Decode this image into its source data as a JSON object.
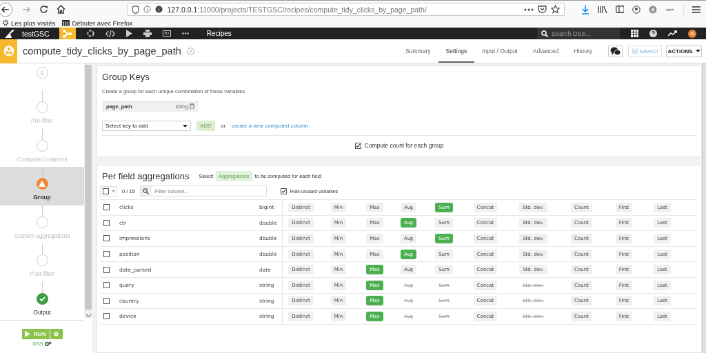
{
  "browser": {
    "url": "**127.0.0.1**:11000/projects/TESTGSC/recipes/compute_tidy_clicks_by_page_path/",
    "bookmarks": [
      "Les plus visités",
      "Débuter avec Firefox"
    ]
  },
  "topbar": {
    "project": "testGSC",
    "section": "Recipes",
    "search": {
      "placeholder": "Search DSS..."
    },
    "avatar": "A"
  },
  "recipe": {
    "title": "compute_tidy_clicks_by_page_path",
    "tabs": [
      {
        "label": "Summary",
        "selected": false
      },
      {
        "label": "Settings",
        "selected": true
      },
      {
        "label": "Input / Output",
        "selected": false
      },
      {
        "label": "Advanced",
        "selected": false
      },
      {
        "label": "History",
        "selected": false
      }
    ],
    "saved": "SAVED!",
    "actions": "ACTIONS"
  },
  "steps": [
    {
      "kind": "input",
      "selected": false
    },
    {
      "kind": "empty",
      "label": "Pre-filter",
      "selected": false
    },
    {
      "kind": "empty",
      "label": "Computed columns",
      "selected": false
    },
    {
      "kind": "warning",
      "label": "Group",
      "selected": true
    },
    {
      "kind": "empty",
      "label": "Custom aggregations",
      "selected": false
    },
    {
      "kind": "empty",
      "label": "Post-filter",
      "selected": false
    },
    {
      "kind": "done",
      "label": "Output",
      "selected": false
    }
  ],
  "run": {
    "label": "RUN",
    "engine": "DSS"
  },
  "group_keys": {
    "title": "Group Keys",
    "description": "Create a group for each unique combination of these variables",
    "keys": [
      {
        "name": "page_path",
        "type": "string"
      }
    ],
    "select": {
      "placeholder": "Select key to add"
    },
    "add": "ADD",
    "or": "or",
    "link": "create a new computed column",
    "compute_count": {
      "label": "Compute count for each group",
      "checked": true
    }
  },
  "aggregations": {
    "title": "Per field aggregations",
    "hint_before": "Select",
    "hint_tag": "Aggregations",
    "hint_after": "to be computed for each field",
    "counter": "0 / 15",
    "filter": {
      "placeholder": "Filter column..."
    },
    "hide_unused": {
      "label": "Hide unused variables",
      "checked": true
    },
    "rows": [
      {
        "name": "clicks",
        "type": "bigint",
        "checked": false,
        "aggs": [
          {
            "label": "Distinct",
            "selected": false,
            "disabled": false
          },
          {
            "label": "Min",
            "selected": false,
            "disabled": false
          },
          {
            "label": "Max",
            "selected": false,
            "disabled": false
          },
          {
            "label": "Avg",
            "selected": false,
            "disabled": false
          },
          {
            "label": "Sum",
            "selected": true,
            "disabled": false
          },
          {
            "label": "Concat",
            "selected": false,
            "disabled": false
          },
          {
            "label": "Std. dev.",
            "selected": false,
            "disabled": false
          },
          {
            "label": "Count",
            "selected": false,
            "disabled": false
          },
          {
            "label": "First",
            "selected": false,
            "disabled": false
          },
          {
            "label": "Last",
            "selected": false,
            "disabled": false
          }
        ]
      },
      {
        "name": "ctr",
        "type": "double",
        "checked": false,
        "aggs": [
          {
            "label": "Distinct",
            "selected": false,
            "disabled": false
          },
          {
            "label": "Min",
            "selected": false,
            "disabled": false
          },
          {
            "label": "Max",
            "selected": false,
            "disabled": false
          },
          {
            "label": "Avg",
            "selected": true,
            "disabled": false
          },
          {
            "label": "Sum",
            "selected": false,
            "disabled": false
          },
          {
            "label": "Concat",
            "selected": false,
            "disabled": false
          },
          {
            "label": "Std. dev.",
            "selected": false,
            "disabled": false
          },
          {
            "label": "Count",
            "selected": false,
            "disabled": false
          },
          {
            "label": "First",
            "selected": false,
            "disabled": false
          },
          {
            "label": "Last",
            "selected": false,
            "disabled": false
          }
        ]
      },
      {
        "name": "impressions",
        "type": "double",
        "checked": false,
        "aggs": [
          {
            "label": "Distinct",
            "selected": false,
            "disabled": false
          },
          {
            "label": "Min",
            "selected": false,
            "disabled": false
          },
          {
            "label": "Max",
            "selected": false,
            "disabled": false
          },
          {
            "label": "Avg",
            "selected": false,
            "disabled": false
          },
          {
            "label": "Sum",
            "selected": true,
            "disabled": false
          },
          {
            "label": "Concat",
            "selected": false,
            "disabled": false
          },
          {
            "label": "Std. dev.",
            "selected": false,
            "disabled": false
          },
          {
            "label": "Count",
            "selected": false,
            "disabled": false
          },
          {
            "label": "First",
            "selected": false,
            "disabled": false
          },
          {
            "label": "Last",
            "selected": false,
            "disabled": false
          }
        ]
      },
      {
        "name": "position",
        "type": "double",
        "checked": false,
        "aggs": [
          {
            "label": "Distinct",
            "selected": false,
            "disabled": false
          },
          {
            "label": "Min",
            "selected": false,
            "disabled": false
          },
          {
            "label": "Max",
            "selected": false,
            "disabled": false
          },
          {
            "label": "Avg",
            "selected": true,
            "disabled": false
          },
          {
            "label": "Sum",
            "selected": false,
            "disabled": false
          },
          {
            "label": "Concat",
            "selected": false,
            "disabled": false
          },
          {
            "label": "Std. dev.",
            "selected": false,
            "disabled": false
          },
          {
            "label": "Count",
            "selected": false,
            "disabled": false
          },
          {
            "label": "First",
            "selected": false,
            "disabled": false
          },
          {
            "label": "Last",
            "selected": false,
            "disabled": false
          }
        ]
      },
      {
        "name": "date_parsed",
        "type": "date",
        "checked": false,
        "aggs": [
          {
            "label": "Distinct",
            "selected": false,
            "disabled": false
          },
          {
            "label": "Min",
            "selected": false,
            "disabled": false
          },
          {
            "label": "Max",
            "selected": true,
            "disabled": false
          },
          {
            "label": "Avg",
            "selected": false,
            "disabled": false
          },
          {
            "label": "Sum",
            "selected": false,
            "disabled": false
          },
          {
            "label": "Concat",
            "selected": false,
            "disabled": false
          },
          {
            "label": "Std. dev.",
            "selected": false,
            "disabled": false
          },
          {
            "label": "Count",
            "selected": false,
            "disabled": false
          },
          {
            "label": "First",
            "selected": false,
            "disabled": false
          },
          {
            "label": "Last",
            "selected": false,
            "disabled": false
          }
        ]
      },
      {
        "name": "query",
        "type": "string",
        "checked": false,
        "aggs": [
          {
            "label": "Distinct",
            "selected": false,
            "disabled": false
          },
          {
            "label": "Min",
            "selected": false,
            "disabled": false
          },
          {
            "label": "Max",
            "selected": true,
            "disabled": false
          },
          {
            "label": "Avg",
            "selected": false,
            "disabled": true
          },
          {
            "label": "Sum",
            "selected": false,
            "disabled": true
          },
          {
            "label": "Concat",
            "selected": false,
            "disabled": false
          },
          {
            "label": "Std. dev.",
            "selected": false,
            "disabled": true
          },
          {
            "label": "Count",
            "selected": false,
            "disabled": false
          },
          {
            "label": "First",
            "selected": false,
            "disabled": false
          },
          {
            "label": "Last",
            "selected": false,
            "disabled": false
          }
        ]
      },
      {
        "name": "country",
        "type": "string",
        "checked": false,
        "aggs": [
          {
            "label": "Distinct",
            "selected": false,
            "disabled": false
          },
          {
            "label": "Min",
            "selected": false,
            "disabled": false
          },
          {
            "label": "Max",
            "selected": true,
            "disabled": false
          },
          {
            "label": "Avg",
            "selected": false,
            "disabled": true
          },
          {
            "label": "Sum",
            "selected": false,
            "disabled": true
          },
          {
            "label": "Concat",
            "selected": false,
            "disabled": false
          },
          {
            "label": "Std. dev.",
            "selected": false,
            "disabled": true
          },
          {
            "label": "Count",
            "selected": false,
            "disabled": false
          },
          {
            "label": "First",
            "selected": false,
            "disabled": false
          },
          {
            "label": "Last",
            "selected": false,
            "disabled": false
          }
        ]
      },
      {
        "name": "device",
        "type": "string",
        "checked": false,
        "aggs": [
          {
            "label": "Distinct",
            "selected": false,
            "disabled": false
          },
          {
            "label": "Min",
            "selected": false,
            "disabled": false
          },
          {
            "label": "Max",
            "selected": true,
            "disabled": false
          },
          {
            "label": "Avg",
            "selected": false,
            "disabled": true
          },
          {
            "label": "Sum",
            "selected": false,
            "disabled": true
          },
          {
            "label": "Concat",
            "selected": false,
            "disabled": false
          },
          {
            "label": "Std. dev.",
            "selected": false,
            "disabled": true
          },
          {
            "label": "Count",
            "selected": false,
            "disabled": false
          },
          {
            "label": "First",
            "selected": false,
            "disabled": false
          },
          {
            "label": "Last",
            "selected": false,
            "disabled": false
          }
        ]
      }
    ]
  }
}
